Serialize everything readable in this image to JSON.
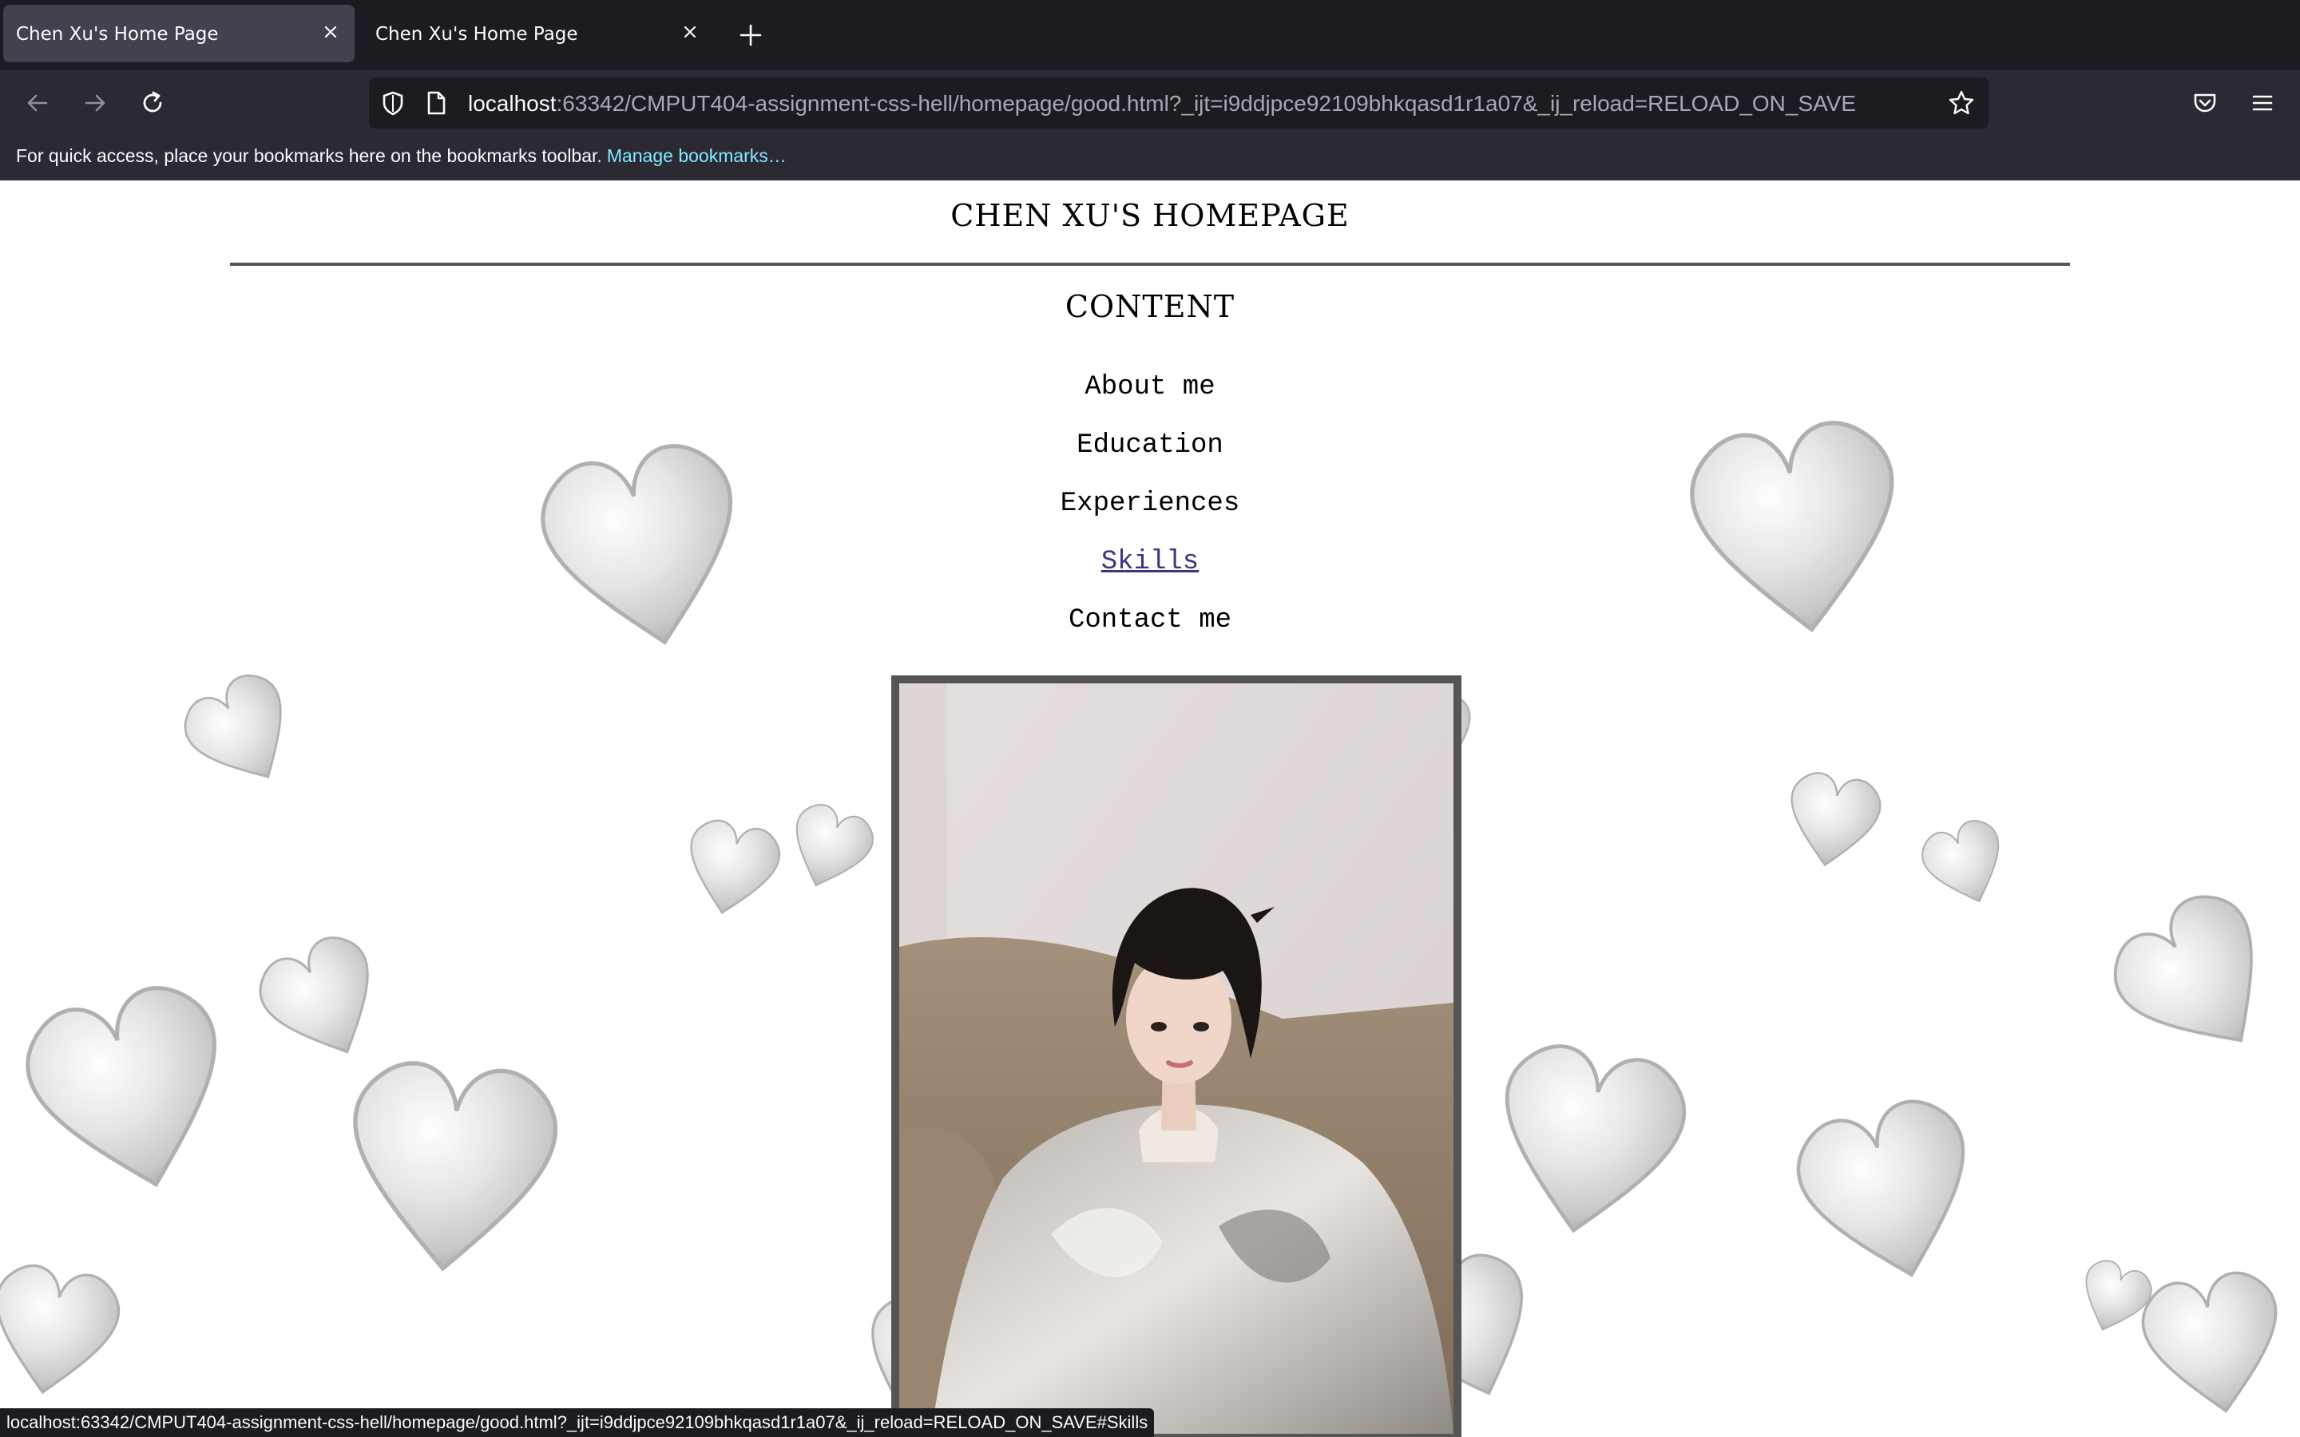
{
  "browser": {
    "tabs": [
      {
        "title": "Chen Xu's Home Page",
        "active": true
      },
      {
        "title": "Chen Xu's Home Page",
        "active": false
      }
    ],
    "url": {
      "host": "localhost",
      "rest": ":63342/CMPUT404-assignment-css-hell/homepage/good.html?_ijt=i9ddjpce92109bhkqasd1r1a07&_ij_reload=RELOAD_ON_SAVE"
    },
    "bookmarks_bar": {
      "message": "For quick access, place your bookmarks here on the bookmarks toolbar.",
      "link": "Manage bookmarks…"
    },
    "status_text": "localhost:63342/CMPUT404-assignment-css-hell/homepage/good.html?_ijt=i9ddjpce92109bhkqasd1r1a07&_ij_reload=RELOAD_ON_SAVE#Skills",
    "icons": {
      "back": "back-arrow-icon",
      "forward": "forward-arrow-icon",
      "reload": "reload-icon",
      "shield": "tracking-protection-shield-icon",
      "page": "page-info-icon",
      "bookmark_star": "bookmark-star-icon",
      "pocket": "pocket-icon",
      "menu": "hamburger-menu-icon",
      "new_tab": "plus-icon",
      "close_tab": "close-icon"
    },
    "colors": {
      "tabstrip_bg": "#1c1b22",
      "toolbar_bg": "#2b2a33",
      "link_accent": "#80ebff"
    }
  },
  "page": {
    "title": "CHEN XU'S HOMEPAGE",
    "content_heading": "CONTENT",
    "nav_items": [
      {
        "label": "About me"
      },
      {
        "label": "Education"
      },
      {
        "label": "Experiences"
      },
      {
        "label": "Skills",
        "hovered": true
      },
      {
        "label": "Contact me"
      }
    ],
    "colors": {
      "hovered_link": "#3d3380",
      "frame_border": "#555555",
      "background": "#ffffff"
    }
  }
}
